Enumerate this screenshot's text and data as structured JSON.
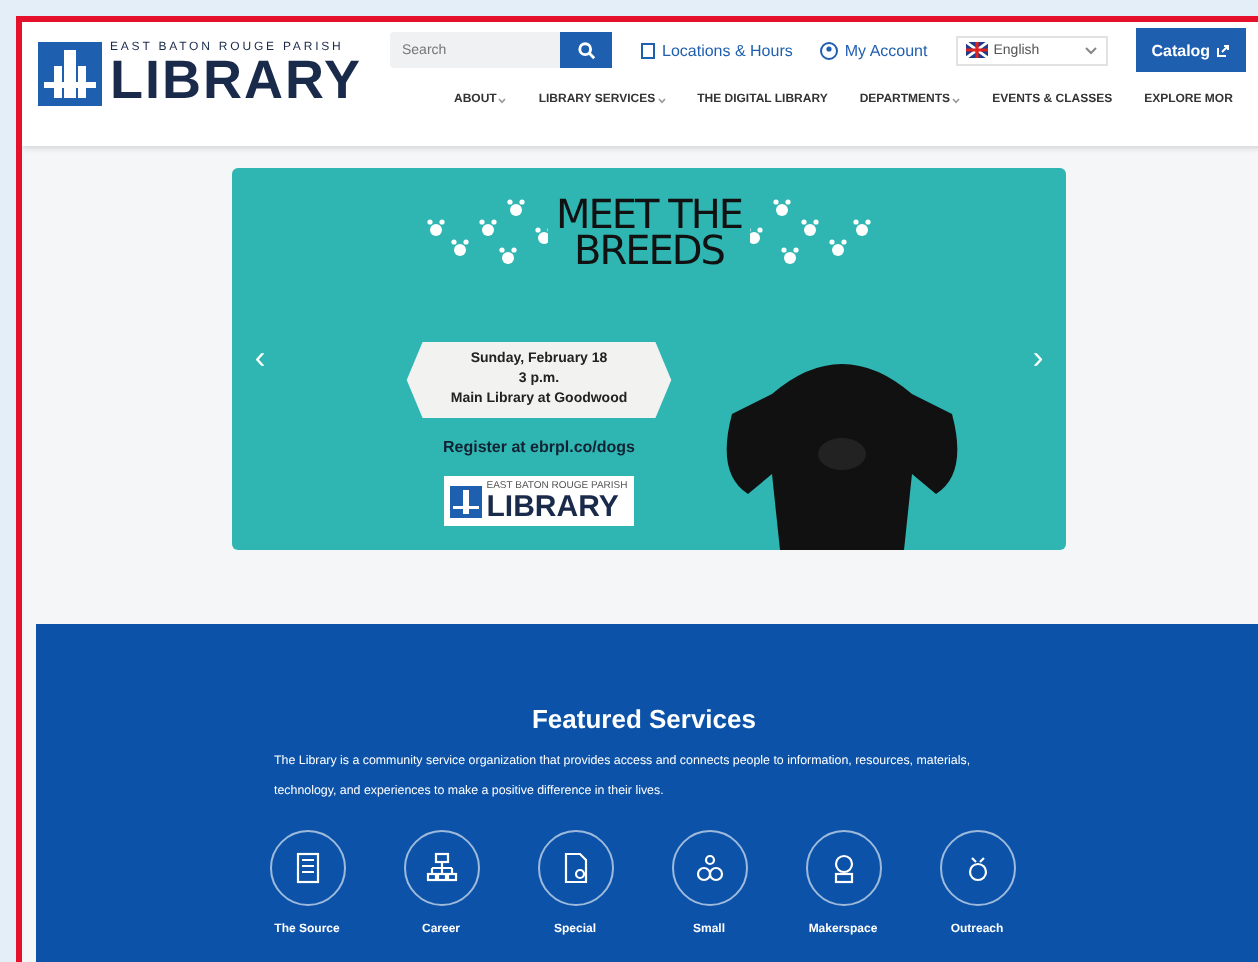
{
  "logo": {
    "tagline": "EAST BATON ROUGE PARISH",
    "name": "LIBRARY"
  },
  "search": {
    "placeholder": "Search"
  },
  "top_links": [
    {
      "label": "Locations & Hours",
      "kind": "location"
    },
    {
      "label": "My Account",
      "kind": "account"
    }
  ],
  "language": {
    "value": "English"
  },
  "catalog_button": "Catalog",
  "nav": [
    {
      "label": "ABOUT",
      "dropdown": true
    },
    {
      "label": "LIBRARY SERVICES",
      "dropdown": true
    },
    {
      "label": "THE DIGITAL LIBRARY",
      "dropdown": false
    },
    {
      "label": "DEPARTMENTS",
      "dropdown": true
    },
    {
      "label": "EVENTS & CLASSES",
      "dropdown": false
    },
    {
      "label": "EXPLORE MOR",
      "dropdown": false
    }
  ],
  "banner": {
    "title": [
      "MEET THE",
      "BREEDS"
    ],
    "details": [
      "Sunday, February 18",
      "3 p.m.",
      "Main Library at Goodwood"
    ],
    "register": "Register at ebrpl.co/dogs",
    "logo_tagline": "EAST BATON ROUGE PARISH",
    "logo_name": "LIBRARY",
    "prev": "‹",
    "next": "›"
  },
  "featured": {
    "title": "Featured Services",
    "description": "The Library is a community service organization that provides access and connects people to information, resources, materials, technology, and experiences to make a positive difference in their lives.",
    "services": [
      {
        "label": "The Source",
        "kind": "newsletter"
      },
      {
        "label": "Career",
        "kind": "career"
      },
      {
        "label": "Special",
        "kind": "collection"
      },
      {
        "label": "Small",
        "kind": "business"
      },
      {
        "label": "Makerspace",
        "kind": "maker"
      },
      {
        "label": "Outreach",
        "kind": "outreach"
      }
    ]
  }
}
